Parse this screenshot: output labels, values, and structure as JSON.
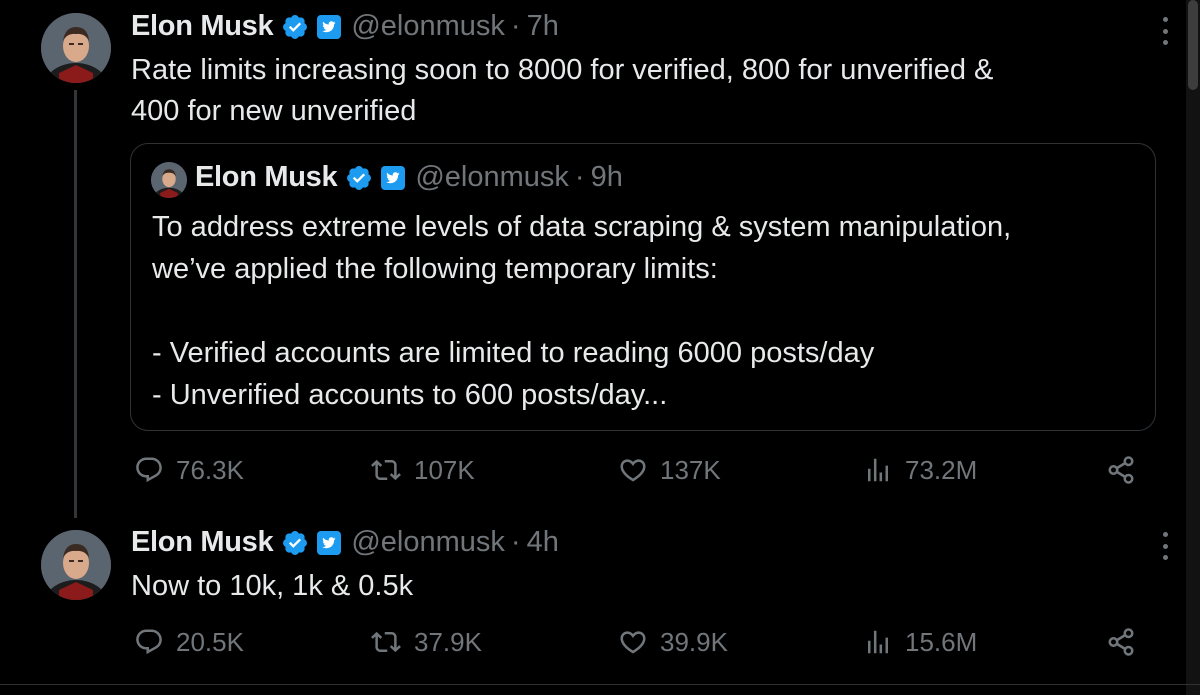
{
  "colors": {
    "background": "#000000",
    "text_primary": "#e7e9ea",
    "text_secondary": "#71767b",
    "verified_blue": "#1d9bf0",
    "border": "#2f3336"
  },
  "tweet1": {
    "author_name": "Elon Musk",
    "handle": "@elonmusk",
    "separator": "·",
    "time": "7h",
    "text": "Rate limits increasing soon to 8000 for verified, 800 for unverified &\n400 for new unverified",
    "quote": {
      "author_name": "Elon Musk",
      "handle": "@elonmusk",
      "separator": "·",
      "time": "9h",
      "text": "To address extreme levels of data scraping & system manipulation,\nwe’ve applied the following temporary limits:\n\n- Verified accounts are limited to reading 6000 posts/day\n- Unverified accounts to 600 posts/day..."
    },
    "actions": {
      "replies": "76.3K",
      "reposts": "107K",
      "likes": "137K",
      "views": "73.2M"
    }
  },
  "tweet2": {
    "author_name": "Elon Musk",
    "handle": "@elonmusk",
    "separator": "·",
    "time": "4h",
    "text": "Now to 10k, 1k & 0.5k",
    "actions": {
      "replies": "20.5K",
      "reposts": "37.9K",
      "likes": "39.9K",
      "views": "15.6M"
    }
  },
  "icons": {
    "reply": "reply-icon",
    "repost": "repost-icon",
    "like": "heart-icon",
    "views": "views-icon",
    "share": "share-icon",
    "verified": "verified-badge-icon",
    "affiliate": "twitter-affiliate-icon",
    "more": "more-options-icon"
  }
}
